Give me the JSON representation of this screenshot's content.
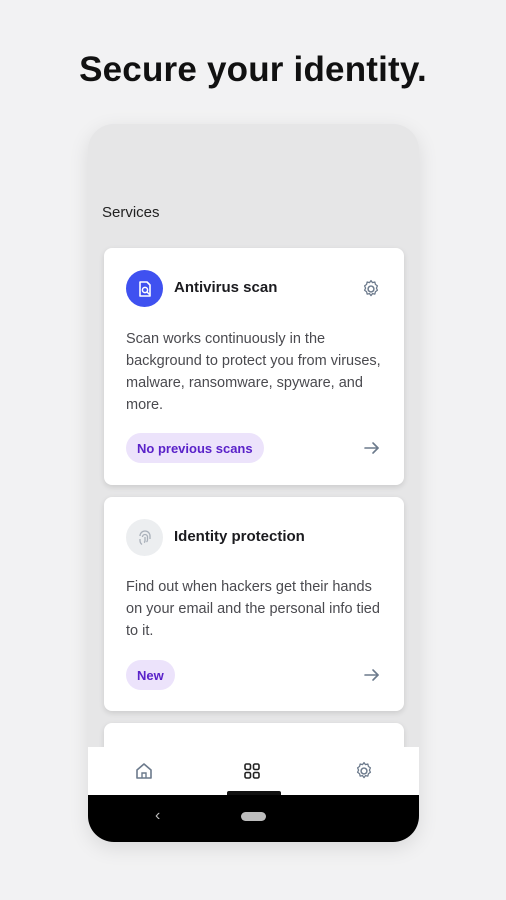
{
  "headline": "Secure your identity.",
  "section_title": "Services",
  "cards": [
    {
      "icon": "antivirus-file-icon",
      "title": "Antivirus scan",
      "description": "Scan works continuously in the background to protect you from viruses, malware, ransomware, spyware, and more.",
      "status": "No previous scans",
      "has_settings": true
    },
    {
      "icon": "fingerprint-icon",
      "title": "Identity protection",
      "description": "Find out when hackers get their hands on your email and the personal info tied to it.",
      "status": "New",
      "has_settings": false
    }
  ],
  "bottom_nav": {
    "items": [
      "home-icon",
      "grid-icon",
      "gear-icon"
    ],
    "active": "grid-icon"
  },
  "system_nav": {
    "back_glyph": "‹"
  },
  "colors": {
    "accent": "#3f51f0",
    "pill_bg": "#ece3fb",
    "pill_text": "#5a22c9",
    "icon_grey": "#6c7a8c"
  }
}
